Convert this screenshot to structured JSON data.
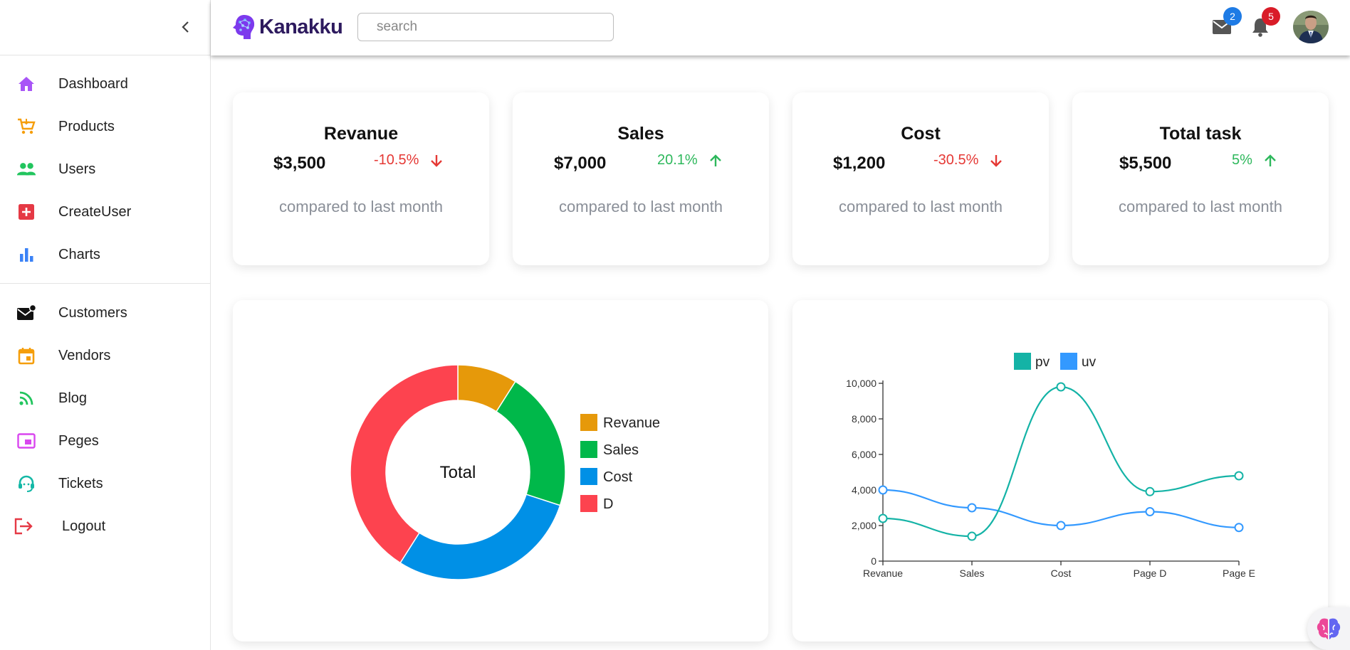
{
  "app": {
    "name": "Kanakku"
  },
  "search": {
    "placeholder": "search",
    "value": ""
  },
  "notifications": {
    "mail_count": "2",
    "bell_count": "5"
  },
  "colors": {
    "purple": "#a855f7",
    "orange": "#f59e0b",
    "green": "#22c55e",
    "red": "#e53945",
    "blue": "#3b82f6",
    "teal": "#14b8a6"
  },
  "sidebar": {
    "items": [
      {
        "label": "Dashboard",
        "icon": "home-icon"
      },
      {
        "label": "Products",
        "icon": "cart-icon"
      },
      {
        "label": "Users",
        "icon": "users-icon"
      },
      {
        "label": "CreateUser",
        "icon": "add-box-icon"
      },
      {
        "label": "Charts",
        "icon": "bar-chart-icon"
      },
      {
        "label": "Customers",
        "icon": "mail-badge-icon"
      },
      {
        "label": "Vendors",
        "icon": "calendar-icon"
      },
      {
        "label": "Blog",
        "icon": "rss-icon"
      },
      {
        "label": "Peges",
        "icon": "picture-in-picture-icon"
      },
      {
        "label": "Tickets",
        "icon": "headset-icon"
      },
      {
        "label": "Logout",
        "icon": "logout-icon"
      }
    ]
  },
  "stats": [
    {
      "title": "Revanue",
      "value": "$3,500",
      "change": "-10.5%",
      "direction": "down",
      "sub": "compared to last month"
    },
    {
      "title": "Sales",
      "value": "$7,000",
      "change": "20.1%",
      "direction": "up",
      "sub": "compared to last month"
    },
    {
      "title": "Cost",
      "value": "$1,200",
      "change": "-30.5%",
      "direction": "down",
      "sub": "compared to last month"
    },
    {
      "title": "Total task",
      "value": "$5,500",
      "change": "5%",
      "direction": "up",
      "sub": "compared to last month"
    }
  ],
  "chart_data": [
    {
      "type": "pie",
      "center_label": "Total",
      "labels": [
        "Revanue",
        "Sales",
        "Cost",
        "D"
      ],
      "values": [
        9,
        21,
        29,
        41
      ],
      "colors": [
        "#e6990a",
        "#00b84a",
        "#0090e6",
        "#fd434f"
      ],
      "legend": "right"
    },
    {
      "type": "line",
      "categories": [
        "Revanue",
        "Sales",
        "Cost",
        "Page D",
        "Page E"
      ],
      "series": [
        {
          "name": "pv",
          "values": [
            2400,
            1398,
            9800,
            3908,
            4800
          ],
          "color": "#14b3a6"
        },
        {
          "name": "uv",
          "values": [
            4000,
            3000,
            2000,
            2780,
            1890
          ],
          "color": "#3399ff"
        }
      ],
      "ylim": [
        0,
        10000
      ],
      "yticks": [
        "0",
        "2,000",
        "4,000",
        "6,000",
        "8,000",
        "10,000"
      ],
      "legend": "top"
    }
  ]
}
